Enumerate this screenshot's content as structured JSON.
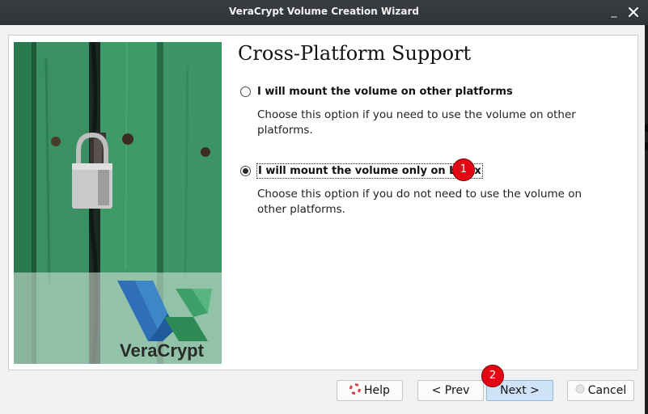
{
  "window": {
    "title": "VeraCrypt Volume Creation Wizard",
    "minimize_glyph": "_"
  },
  "side_image": {
    "description_icon": "padlock-on-green-door-image",
    "logo_text": "VeraCrypt"
  },
  "page": {
    "heading": "Cross-Platform Support",
    "options": [
      {
        "label": "I will mount the volume on other platforms",
        "description": "Choose this option if you need to use the volume on other platforms.",
        "selected": false
      },
      {
        "label": "I will mount the volume only on Linux",
        "description": "Choose this option if you do not need to use the volume on other platforms.",
        "selected": true
      }
    ]
  },
  "markers": [
    "1",
    "2"
  ],
  "buttons": {
    "help": "Help",
    "prev": "< Prev",
    "next": "Next >",
    "cancel": "Cancel"
  },
  "colors": {
    "marker": "#e30613",
    "primary_button": "#cfe3f7",
    "door_green": "#3e8a5f"
  }
}
